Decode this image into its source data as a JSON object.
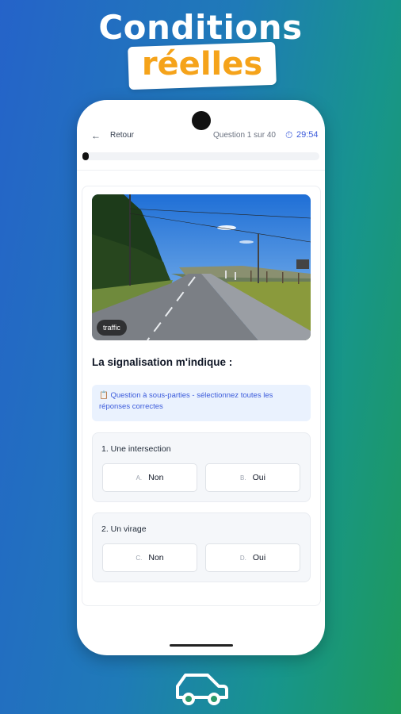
{
  "promo": {
    "headline": "Conditions",
    "highlight": "réelles"
  },
  "topbar": {
    "back_label": "Retour",
    "counter": "Question 1 sur 40",
    "timer": "29:54",
    "progress_fraction": 0.025
  },
  "image": {
    "tag": "traffic"
  },
  "question": {
    "text": "La signalisation m'indique :",
    "notice": "📋 Question à sous-parties - sélectionnez toutes les réponses correctes"
  },
  "subparts": [
    {
      "title": "1. Une intersection",
      "options": [
        {
          "letter": "A.",
          "label": "Non"
        },
        {
          "letter": "B.",
          "label": "Oui"
        }
      ]
    },
    {
      "title": "2. Un virage",
      "options": [
        {
          "letter": "C.",
          "label": "Non"
        },
        {
          "letter": "D.",
          "label": "Oui"
        }
      ]
    }
  ],
  "icons": {
    "back": "arrow-left-icon",
    "timer": "stopwatch-icon",
    "footer": "car-icon"
  },
  "colors": {
    "accent": "#3b5bdb",
    "highlight": "#f5a31a"
  }
}
